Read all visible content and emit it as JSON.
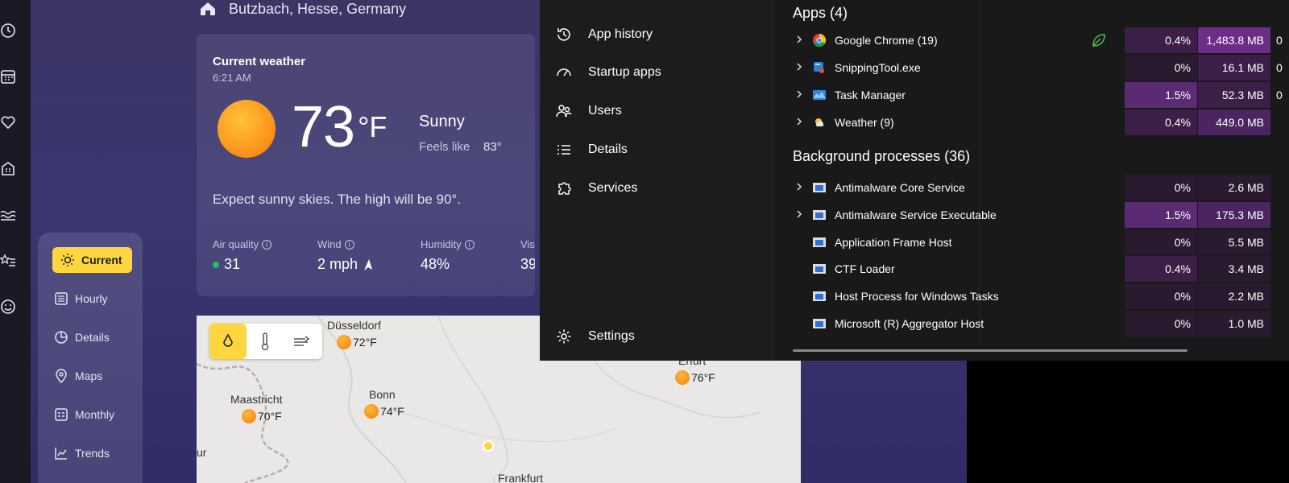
{
  "weather": {
    "location": "Butzbach, Hesse, Germany",
    "current": {
      "title": "Current weather",
      "time": "6:21 AM",
      "temp": "73",
      "unit": "°F",
      "condition": "Sunny",
      "feels_like_label": "Feels like",
      "feels_like_value": "83°",
      "summary": "Expect sunny skies. The high will be 90°.",
      "metrics": [
        {
          "label": "Air quality",
          "value": "31"
        },
        {
          "label": "Wind",
          "value": "2 mph"
        },
        {
          "label": "Humidity",
          "value": "48%"
        },
        {
          "label": "Visi",
          "value": "39"
        }
      ]
    },
    "nav": [
      {
        "label": "Current",
        "icon": "sun-icon",
        "active": true
      },
      {
        "label": "Hourly",
        "icon": "hourly-icon"
      },
      {
        "label": "Details",
        "icon": "pie-icon"
      },
      {
        "label": "Maps",
        "icon": "map-pin-icon"
      },
      {
        "label": "Monthly",
        "icon": "calendar-icon"
      },
      {
        "label": "Trends",
        "icon": "trends-icon"
      }
    ],
    "rail_icons": [
      "clock-icon",
      "calendar-icon",
      "heart-icon",
      "building-icon",
      "waves-icon",
      "star-list-icon",
      "smiley-icon"
    ],
    "map": {
      "toolbar": [
        "precipitation-icon",
        "temperature-icon",
        "wind-icon"
      ],
      "cities": [
        {
          "name": "Düsseldorf",
          "temp": "72°F"
        },
        {
          "name": "Maastricht",
          "temp": "70°F"
        },
        {
          "name": "Bonn",
          "temp": "74°F"
        },
        {
          "name": "Erfurt",
          "temp": "76°F"
        },
        {
          "name": "Frankfurt"
        },
        {
          "name": "ur"
        }
      ]
    },
    "colors": {
      "accent": "#ffd640",
      "sun": "#ff9a1f",
      "aq_good": "#1fbf6a"
    }
  },
  "task_manager": {
    "nav": [
      {
        "label": "App history",
        "icon": "history-icon"
      },
      {
        "label": "Startup apps",
        "icon": "speedometer-icon"
      },
      {
        "label": "Users",
        "icon": "users-icon"
      },
      {
        "label": "Details",
        "icon": "list-icon"
      },
      {
        "label": "Services",
        "icon": "puzzle-icon"
      },
      {
        "label": "Settings",
        "icon": "gear-icon"
      }
    ],
    "apps_title": "Apps (4)",
    "apps": [
      {
        "name": "Google Chrome (19)",
        "cpu": "0.4%",
        "mem": "1,483.8 MB",
        "rest": "0",
        "icon": "chrome-icon",
        "efficiency": true
      },
      {
        "name": "SnippingTool.exe",
        "cpu": "0%",
        "mem": "16.1 MB",
        "rest": "0",
        "icon": "snipping-icon"
      },
      {
        "name": "Task Manager",
        "cpu": "1.5%",
        "mem": "52.3 MB",
        "rest": "0",
        "icon": "task-manager-icon"
      },
      {
        "name": "Weather (9)",
        "cpu": "0.4%",
        "mem": "449.0 MB",
        "rest": "",
        "icon": "weather-icon"
      }
    ],
    "bg_title": "Background processes (36)",
    "background": [
      {
        "name": "Antimalware Core Service",
        "cpu": "0%",
        "mem": "2.6 MB",
        "expand": true
      },
      {
        "name": "Antimalware Service Executable",
        "cpu": "1.5%",
        "mem": "175.3 MB",
        "expand": true
      },
      {
        "name": "Application Frame Host",
        "cpu": "0%",
        "mem": "5.5 MB"
      },
      {
        "name": "CTF Loader",
        "cpu": "0.4%",
        "mem": "3.4 MB"
      },
      {
        "name": "Host Process for Windows Tasks",
        "cpu": "0%",
        "mem": "2.2 MB"
      },
      {
        "name": "Microsoft (R) Aggregator Host",
        "cpu": "0%",
        "mem": "1.0 MB"
      }
    ]
  }
}
